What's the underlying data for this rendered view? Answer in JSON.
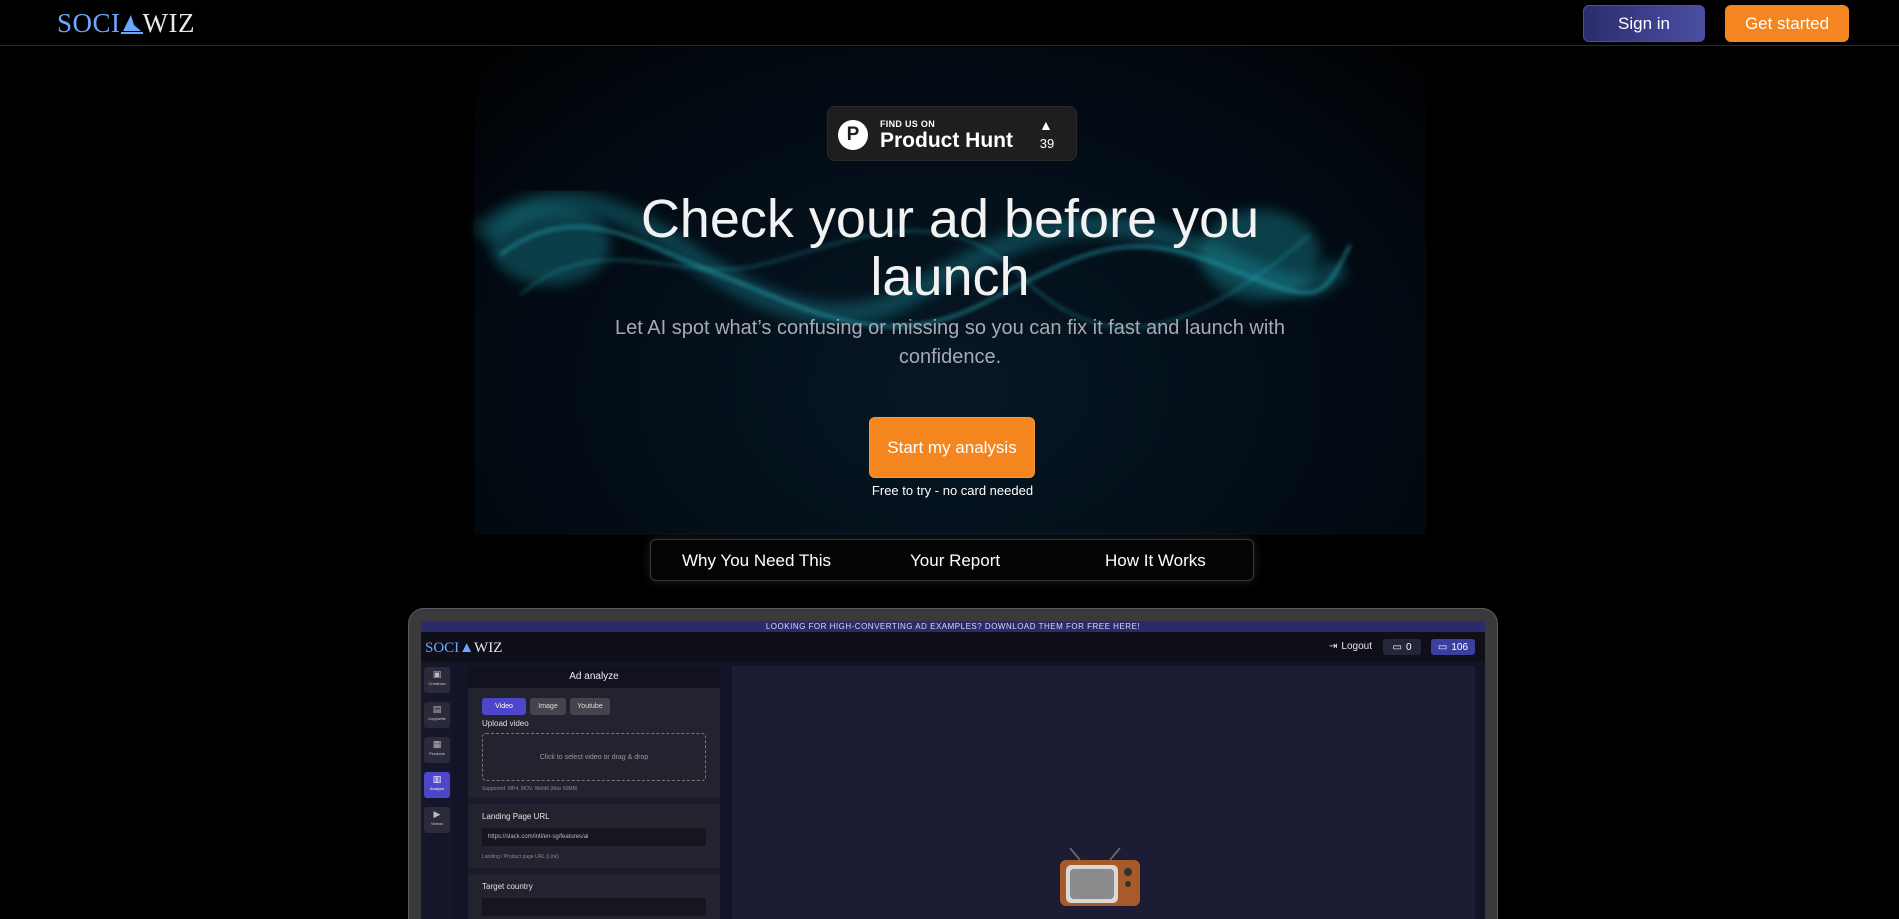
{
  "nav": {
    "logo_left": "SOCI",
    "logo_right": "WIZ",
    "sign_in": "Sign in",
    "get_started": "Get started"
  },
  "product_hunt": {
    "small": "FIND US ON",
    "big": "Product Hunt",
    "arrow": "▲",
    "count": "39"
  },
  "hero": {
    "title": "Check your ad before you launch",
    "subtitle": "Let AI spot what’s confusing or missing so you can fix it fast and launch with confidence.",
    "cta": "Start my analysis",
    "note": "Free to try - no card needed"
  },
  "section_tabs": [
    "Why You Need This",
    "Your Report",
    "How It Works"
  ],
  "app_preview": {
    "promo": "LOOKING FOR HIGH-CONVERTING AD EXAMPLES? DOWNLOAD THEM FOR FREE HERE!",
    "logo_left": "SOCI",
    "logo_right": "WIZ",
    "logout": "Logout",
    "credits_a": "0",
    "credits_b": "106",
    "side_nav": [
      "Creatives",
      "Copywrite",
      "Products",
      "Analyze",
      "Videos"
    ],
    "panel_title": "Ad analyze",
    "tabs": [
      "Video",
      "Image",
      "Youtube"
    ],
    "upload_label": "Upload video",
    "dropzone": "Click to select video or drag & drop",
    "supported": "Supported: MP4, MOV, WebM (Max 50MB)",
    "landing_label": "Landing Page URL",
    "landing_value": "https://slack.com/intl/en-sg/features/ai",
    "landing_hint": "Landing / Product page URL (Link)",
    "country_label": "Target country"
  },
  "colors": {
    "accent_orange": "#f5851f",
    "accent_indigo": "#4b47c8",
    "logo_blue": "#6aa8ff"
  }
}
